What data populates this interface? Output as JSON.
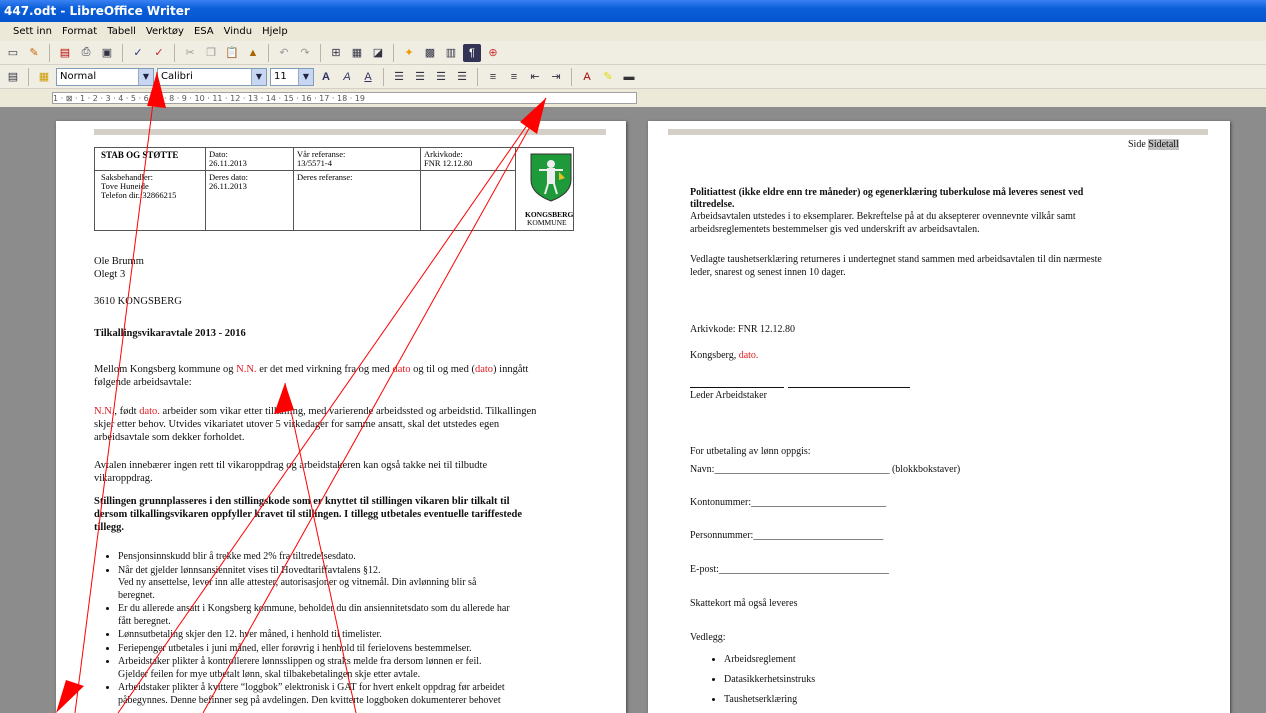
{
  "window": {
    "title": "447.odt - LibreOffice Writer"
  },
  "menu": [
    "Sett inn",
    "Format",
    "Tabell",
    "Verktøy",
    "ESA",
    "Vindu",
    "Hjelp"
  ],
  "format_bar": {
    "style": "Normal",
    "font": "Calibri",
    "size": "11"
  },
  "ruler": {
    "marks": "1 · ⊠ · 1 · 2 · 3 · 4 · 5 · 6 · 7 · 8 · 9 · 10 · 11 · 12 · 13 · 14 · 15 · 16 · 17 · 18 · 19"
  },
  "page1": {
    "header": {
      "unit": "STAB OG STØTTE",
      "dato_label": "Dato:",
      "dato": "26.11.2013",
      "var_ref_label": "Vår referanse:",
      "var_ref": "13/5571-4",
      "arkivkode_label": "Arkivkode:",
      "arkivkode": "FNR 12.12.80",
      "saksbehandler_label": "Saksbehandler:",
      "saksbehandler": "Tove Huneide",
      "telefon": "Telefon dir.:32866215",
      "deres_dato_label": "Deres dato:",
      "deres_dato": "26.11.2013",
      "deres_ref_label": "Deres referanse:",
      "logo_text_1": "KONGSBERG",
      "logo_text_2": "KOMMUNE"
    },
    "recipient": [
      "Ole Brumm",
      "Olegt 3",
      "3610 KONGSBERG"
    ],
    "title": "Tilkallingsvikaravtale 2013 - 2016",
    "para1": {
      "a": "Mellom Kongsberg kommune og ",
      "nn": "N.N.",
      "b": " er det med virkning fra og med ",
      "dato": "dato",
      "c": " og til og med (",
      "dato2": "dato",
      "d": ") inngått",
      "e": "følgende arbeidsavtale:"
    },
    "para2": {
      "nn": "N.N.",
      "a": ", født ",
      "dato": "dato.",
      "b": " arbeider som vikar etter tilkalling, med varierende arbeidssted og arbeidstid. Tilkallingen",
      "c": "skjer etter behov. Utvides vikariatet utover 5 virkedager for samme ansatt, skal det utstedes egen",
      "d": "arbeidsavtale som dekker forholdet."
    },
    "para3": [
      "Avtalen innebærer ingen rett til vikaroppdrag og arbeidstakeren kan også takke nei til tilbudte",
      "vikaroppdrag."
    ],
    "para4": [
      "Stillingen grunnplasseres i den stillingskode som er knyttet til stillingen vikaren blir tilkalt til",
      "dersom tilkallingsvikaren oppfyller kravet til stillingen. I tillegg utbetales eventuelle tariffestede",
      "tillegg."
    ],
    "bullets": [
      "Pensjonsinnskudd blir å trekke med 2% fra tiltredelsesdato.",
      "Når det gjelder lønnsansiennitet vises til Hovedtariffavtalens §12.",
      "Ved ny ansettelse, lever inn alle attester, autorisasjoner og vitnemål. Din avlønning blir så",
      "beregnet.",
      "Er du allerede ansatt i Kongsberg kommune, beholder du din ansiennitetsdato som du allerede har",
      "fått beregnet.",
      "Lønnsutbetaling skjer den 12. hver måned, i henhold til timelister.",
      "Feriepenger utbetales i juni måned, eller forøvrig i henhold til ferielovens bestemmelser.",
      "Arbeidstaker plikter å kontrollerere lønnsslippen og straks melde fra dersom lønnen er feil.",
      "Gjelder feilen for mye utbetalt lønn, skal tilbakebetalingen skje etter avtale.",
      "Arbeidstaker plikter å kvittere “loggbok” elektronisk i GAT for hvert enkelt oppdrag før arbeidet",
      "påbegynnes. Denne befinner seg på avdelingen. Den kvitterte loggboken dokumenterer behovet"
    ]
  },
  "page2": {
    "side_label": "Side",
    "sidetall": "Sidetall",
    "heading": [
      "Politiattest (ikke eldre enn tre måneder) og egenerklæring tuberkulose må leveres senest ved",
      "tiltredelse."
    ],
    "p1": [
      "Arbeidsavtalen utstedes i to eksemplarer. Bekreftelse på at du aksepterer ovennevnte vilkår samt",
      "arbeidsreglementets bestemmelser gis ved underskrift av arbeidsavtalen."
    ],
    "p2": [
      "Vedlagte taushetserklæring returneres i undertegnet stand sammen med arbeidsavtalen til din nærmeste",
      "leder, snarest og senest innen 10 dager."
    ],
    "arkivkode": "Arkivkode: FNR 12.12.80",
    "sted": "Kongsberg, ",
    "sted_dato": "dato.",
    "signatures": "Leder Arbeidstaker",
    "lonn": "For utbetaling av lønn oppgis:",
    "navn": "Navn:___________________________________ (blokkbokstaver)",
    "konto": "Kontonummer:___________________________",
    "person": "Personnummer:__________________________",
    "epost": "E-post:__________________________________",
    "skattekort": "Skattekort må også leveres",
    "vedlegg": "Vedlegg:",
    "vedlegg_items": [
      "Arbeidsreglement",
      "Datasikkerhetsinstruks",
      "Taushetserklæring"
    ]
  },
  "colors": {
    "arrow": "#ff0000",
    "titlebar": "#0a5ed8"
  }
}
